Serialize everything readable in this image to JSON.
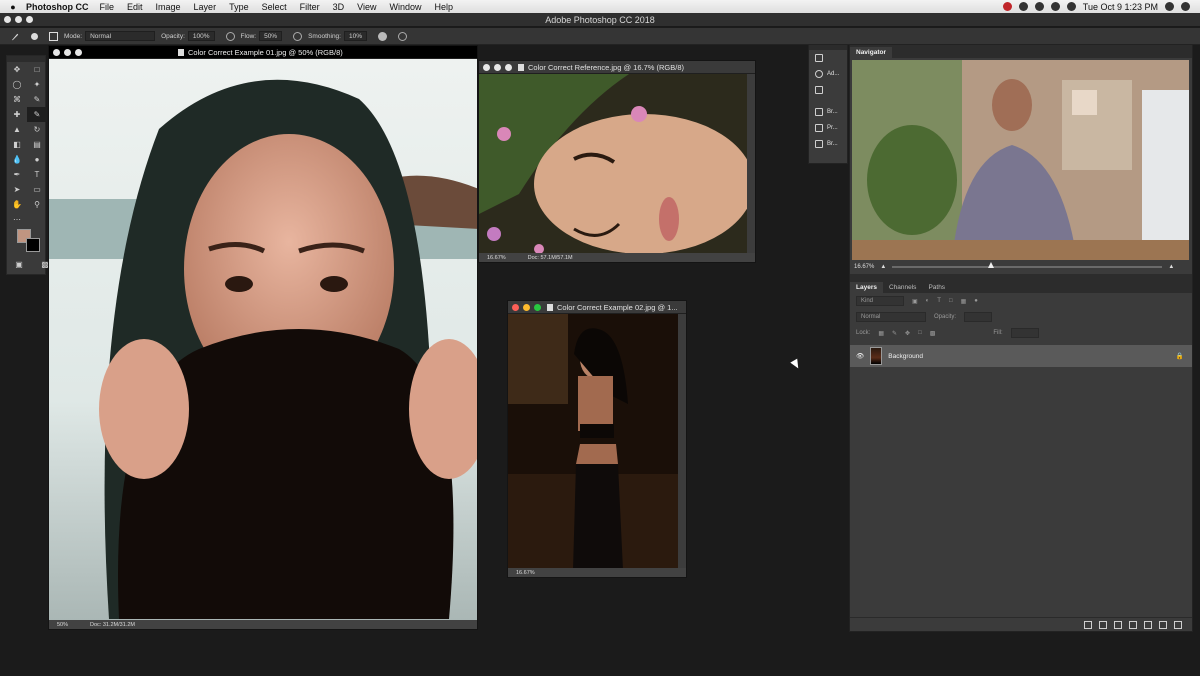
{
  "menubar": {
    "app_name": "Photoshop CC",
    "items": [
      "File",
      "Edit",
      "Image",
      "Layer",
      "Type",
      "Select",
      "Filter",
      "3D",
      "View",
      "Window",
      "Help"
    ],
    "clock": "Tue Oct 9  1:23 PM"
  },
  "app_title": "Adobe Photoshop CC 2018",
  "options_bar": {
    "mode_label": "Mode:",
    "mode_value": "Normal",
    "opacity_label": "Opacity:",
    "opacity_value": "100%",
    "flow_label": "Flow:",
    "flow_value": "50%",
    "smoothing_label": "Smoothing:",
    "smoothing_value": "10%"
  },
  "documents": [
    {
      "title": "Color Correct Example 01.jpg @ 50% (RGB/8)",
      "zoom": "50%",
      "doc_info": "Doc: 31.2M/31.2M"
    },
    {
      "title": "Color Correct Reference.jpg @ 16.7% (RGB/8)",
      "zoom": "16.67%",
      "doc_info": "Doc: 57.1M/57.1M"
    },
    {
      "title": "Color Correct Example 02.jpg @ 1...",
      "zoom": "16.67%"
    }
  ],
  "mini_panel": {
    "items": [
      "Ad...",
      "Br...",
      "Pr...",
      "Br..."
    ]
  },
  "navigator": {
    "tab": "Navigator",
    "zoom": "16.67%"
  },
  "layers_panel": {
    "tabs": [
      "Layers",
      "Channels",
      "Paths"
    ],
    "kind_placeholder": "Kind",
    "blend_mode": "Normal",
    "opacity_label": "Opacity:",
    "lock_label": "Lock:",
    "fill_label": "Fill:",
    "layer_name": "Background"
  },
  "colors": {
    "foreground": "#c09581",
    "background": "#000000"
  }
}
